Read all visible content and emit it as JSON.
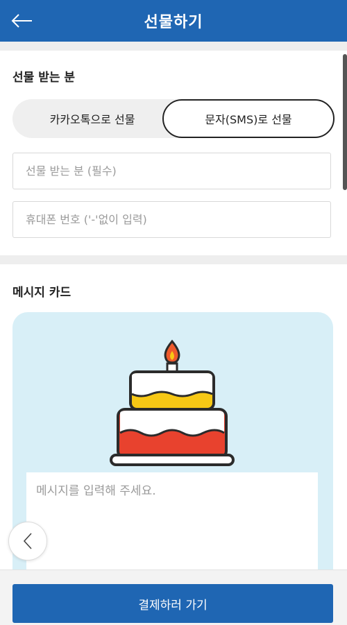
{
  "header": {
    "title": "선물하기",
    "back_icon": "arrow-left-icon"
  },
  "recipient": {
    "section_title": "선물 받는 분",
    "toggle": {
      "options": [
        "카카오톡으로 선물",
        "문자(SMS)로 선물"
      ],
      "selected": "문자(SMS)로 선물"
    },
    "name_placeholder": "선물 받는 분 (필수)",
    "name_value": "",
    "phone_placeholder": "휴대폰 번호 ('-'없이 입력)",
    "phone_value": ""
  },
  "message_card": {
    "section_title": "메시지 카드",
    "image": "birthday-cake",
    "message_placeholder": "메시지를 입력해 주세요.",
    "message_value": "",
    "card_color": "#d8eff7",
    "prev_icon": "chevron-left-icon"
  },
  "footer": {
    "pay_label": "결제하러 가기"
  },
  "colors": {
    "brand": "#1f66b3",
    "background": "#eeeeee",
    "cake_frosting_yellow": "#f7c815",
    "cake_red": "#e8422e",
    "flame": "#ee5a2c"
  }
}
